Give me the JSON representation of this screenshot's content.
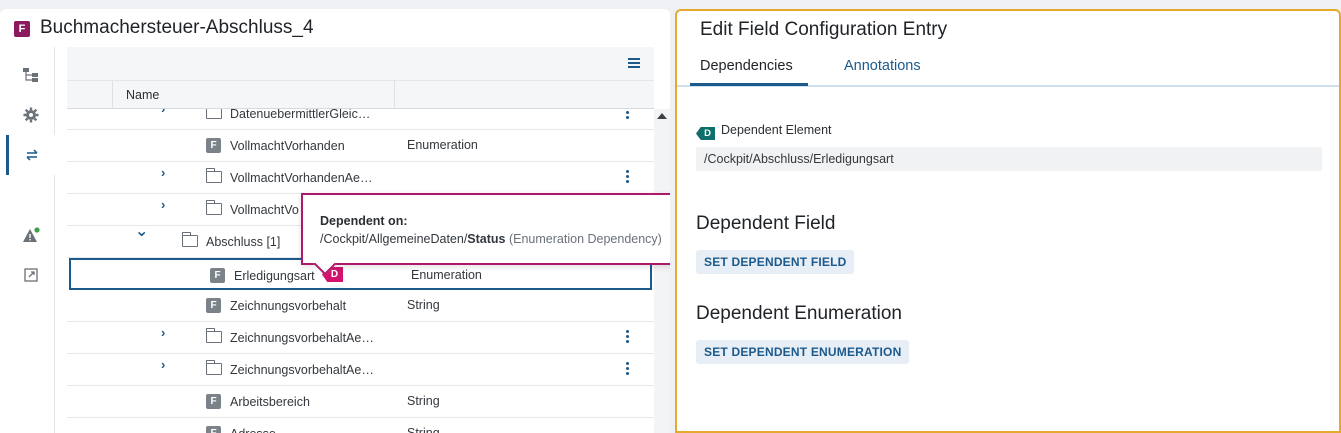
{
  "left": {
    "doc_badge": "F",
    "title": "Buchmachersteuer-Abschluss_4",
    "column_name": "Name",
    "rows": [
      {
        "label": "DatenuebermittlerGleic…",
        "type": "",
        "kind": "folder",
        "indent": 1,
        "expanded": false,
        "kebab": true
      },
      {
        "label": "VollmachtVorhanden",
        "type": "Enumeration",
        "kind": "field",
        "indent": 1
      },
      {
        "label": "VollmachtVorhandenAe…",
        "type": "",
        "kind": "folder",
        "indent": 1,
        "expanded": false,
        "kebab": true
      },
      {
        "label": "VollmachtVo",
        "type": "",
        "kind": "folder",
        "indent": 1,
        "expanded": false
      },
      {
        "label": "Abschluss [1]",
        "type": "",
        "kind": "folder",
        "indent": 0,
        "expanded": true
      },
      {
        "label": "Erledigungsart",
        "type": "Enumeration",
        "kind": "field",
        "indent": 1,
        "selected": true,
        "dependency_tag": "D"
      },
      {
        "label": "Zeichnungsvorbehalt",
        "type": "String",
        "kind": "field",
        "indent": 1
      },
      {
        "label": "ZeichnungsvorbehaltAe…",
        "type": "",
        "kind": "folder",
        "indent": 1,
        "expanded": false,
        "kebab": true
      },
      {
        "label": "ZeichnungsvorbehaltAe…",
        "type": "",
        "kind": "folder",
        "indent": 1,
        "expanded": false,
        "kebab": true
      },
      {
        "label": "Arbeitsbereich",
        "type": "String",
        "kind": "field",
        "indent": 1
      },
      {
        "label": "Adresse…",
        "type": "String",
        "kind": "field",
        "indent": 1
      }
    ]
  },
  "tooltip": {
    "title": "Dependent on:",
    "path_prefix": "/Cockpit/AllgemeineDaten/",
    "path_bold": "Status",
    "note": "(Enumeration Dependency)"
  },
  "right": {
    "title": "Edit Field Configuration Entry",
    "tabs": [
      {
        "label": "Dependencies",
        "active": true
      },
      {
        "label": "Annotations",
        "active": false
      }
    ],
    "dependent_element": {
      "badge": "D",
      "label": "Dependent Element",
      "value": "/Cockpit/Abschluss/Erledigungsart"
    },
    "dependent_field": {
      "title": "Dependent Field",
      "button": "SET DEPENDENT FIELD"
    },
    "dependent_enumeration": {
      "title": "Dependent Enumeration",
      "button": "SET DEPENDENT ENUMERATION"
    }
  },
  "colors": {
    "accent": "#1c5a8c",
    "brand_badge": "#8b1a5e",
    "dependency_tag": "#d4126d",
    "dependent_badge": "#0d6e6b",
    "right_panel_border": "#e5a92b"
  }
}
